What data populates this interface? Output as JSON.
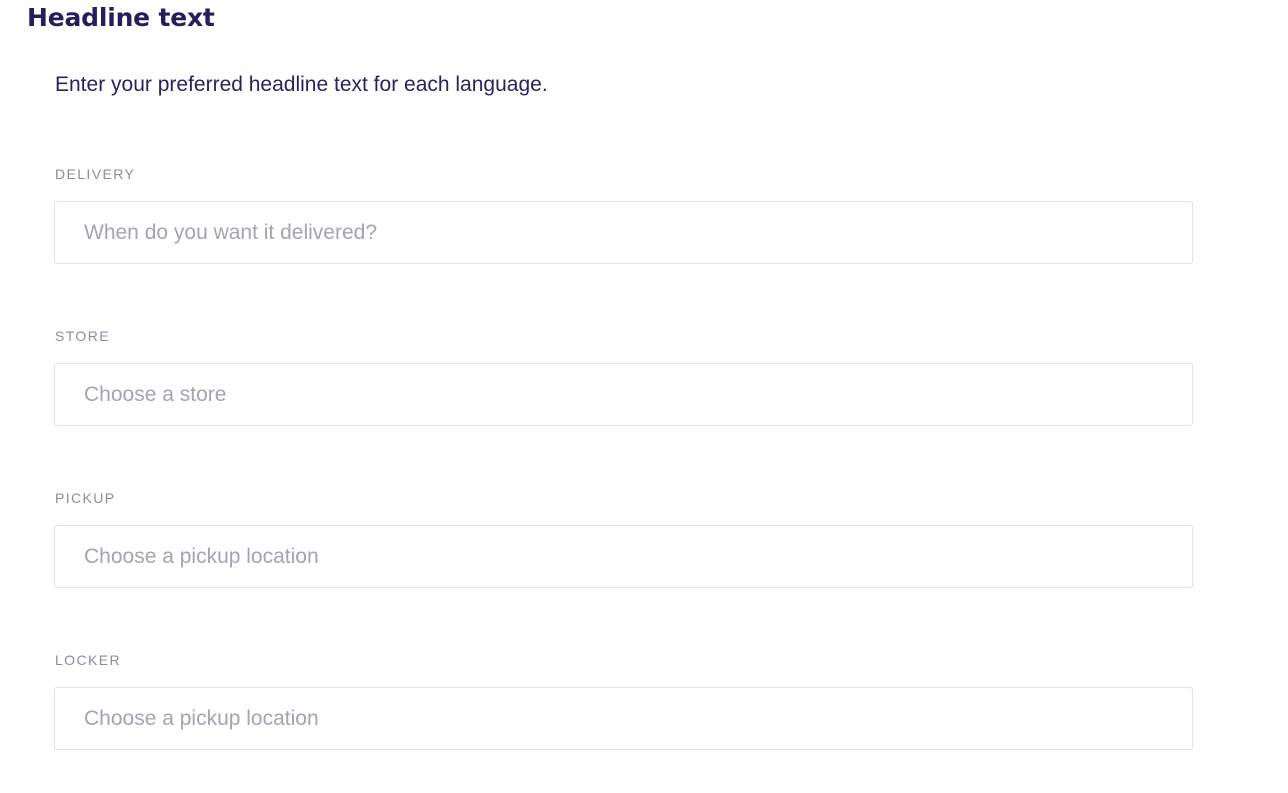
{
  "header": {
    "title": "Headline text",
    "description": "Enter your preferred headline text for each language."
  },
  "fields": [
    {
      "label": "DELIVERY",
      "value": "",
      "placeholder": "When do you want it delivered?"
    },
    {
      "label": "STORE",
      "value": "",
      "placeholder": "Choose a store"
    },
    {
      "label": "PICKUP",
      "value": "",
      "placeholder": "Choose a pickup location"
    },
    {
      "label": "LOCKER",
      "value": "",
      "placeholder": "Choose a pickup location"
    }
  ],
  "colors": {
    "title": "#261d5c",
    "description": "#2a2260",
    "label": "#8b8ba0",
    "placeholder": "#a4a4b0",
    "border": "#e1e1e6"
  }
}
